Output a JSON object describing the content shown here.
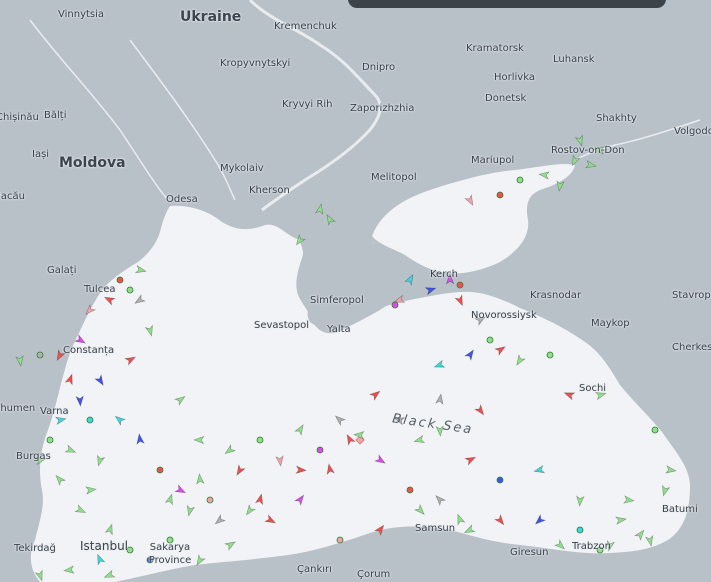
{
  "map": {
    "water_label": "Black Sea",
    "countries": [
      {
        "name": "Ukraine"
      },
      {
        "name": "Moldova"
      }
    ],
    "cities": [
      "Vinnytsia",
      "Kremenchuk",
      "Kramatorsk",
      "Luhansk",
      "Kropyvnytskyi",
      "Dnipro",
      "Horlivka",
      "Donetsk",
      "Kryvyi Rih",
      "Zaporizhzhia",
      "Shakhty",
      "Volgodo",
      "Bălți",
      "Mykolaiv",
      "Mariupol",
      "Rostov-on-Don",
      "Kherson",
      "Melitopol",
      "Odesa",
      "Iași",
      "Bacău",
      "Galați",
      "Tulcea",
      "Kerch",
      "Simferopol",
      "Krasnodar",
      "Stavropo",
      "Sevastopol",
      "Yalta",
      "Novorossiysk",
      "Maykop",
      "Constanța",
      "Cherkes",
      "Sochi",
      "Shumen",
      "Varna",
      "Burgas",
      "Batumi",
      "Sakarya Province",
      "Samsun",
      "Giresun",
      "Trabzon",
      "Tekirdağ",
      "Istanbul",
      "Çankırı",
      "Çorum",
      "Chișinău"
    ]
  },
  "colors": {
    "land": "#b9c1c8",
    "water": "#f2f3f6",
    "cargo": "#8fe08a",
    "tanker": "#ef5050",
    "passenger": "#4257e6",
    "tug": "#3fd6de",
    "pleasure": "#d850e6",
    "unknown": "#f2a3a8",
    "other": "#b0b0b0"
  },
  "vessels": [
    {
      "type": "cargo",
      "dir": 30
    },
    {
      "type": "cargo",
      "dir": 200
    },
    {
      "type": "tanker",
      "dir": 90
    },
    {
      "type": "cargo",
      "dir": 310
    },
    {
      "type": "tug",
      "dir": 0
    },
    {
      "type": "cargo",
      "dir": 150
    },
    {
      "type": "tanker",
      "dir": 250
    },
    {
      "type": "cargo",
      "dir": 60
    },
    {
      "type": "cargo",
      "dir": 180
    },
    {
      "type": "unknown",
      "dir": 45
    },
    {
      "type": "cargo",
      "dir": 120
    },
    {
      "type": "tanker",
      "dir": 330
    },
    {
      "type": "cargo",
      "dir": 270
    },
    {
      "type": "tug",
      "dir": 90
    },
    {
      "type": "cargo",
      "dir": 15
    },
    {
      "type": "passenger",
      "dir": 200
    },
    {
      "type": "cargo",
      "dir": 100
    },
    {
      "type": "tanker",
      "dir": 20
    },
    {
      "type": "cargo",
      "dir": 230
    },
    {
      "type": "pleasure",
      "dir": 80
    }
  ]
}
